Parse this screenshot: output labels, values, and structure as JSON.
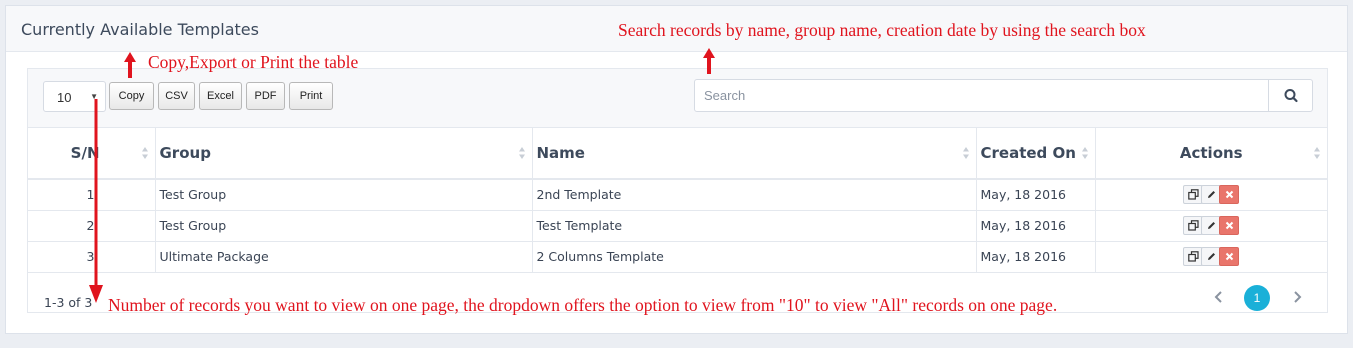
{
  "panel": {
    "title": "Currently Available Templates"
  },
  "toolbar": {
    "page_length": "10",
    "export_buttons": [
      "Copy",
      "CSV",
      "Excel",
      "PDF",
      "Print"
    ],
    "search_placeholder": "Search"
  },
  "table": {
    "columns": [
      "S/N",
      "Group",
      "Name",
      "Created On",
      "Actions"
    ],
    "rows": [
      {
        "sn": "1",
        "group": "Test Group",
        "name": "2nd Template",
        "created": "May, 18 2016"
      },
      {
        "sn": "2",
        "group": "Test Group",
        "name": "Test Template",
        "created": "May, 18 2016"
      },
      {
        "sn": "3",
        "group": "Ultimate Package",
        "name": "2 Columns Template",
        "created": "May, 18 2016"
      }
    ],
    "action_icons": [
      "copy-icon",
      "pencil-icon",
      "delete-x-icon"
    ]
  },
  "footer": {
    "info": "1-3 of 3",
    "current_page": "1"
  },
  "annotations": {
    "export_note": "Copy,Export or Print the table",
    "search_note": "Search records by name, group name, creation date by using the search box",
    "length_note": "Number of records you want to view on one page, the dropdown offers the option to view from \"10\" to view \"All\" records on one page."
  },
  "colors": {
    "annotation_red": "#e0141e",
    "pagination_active": "#1ab0d8",
    "delete_button": "#e9756b"
  }
}
